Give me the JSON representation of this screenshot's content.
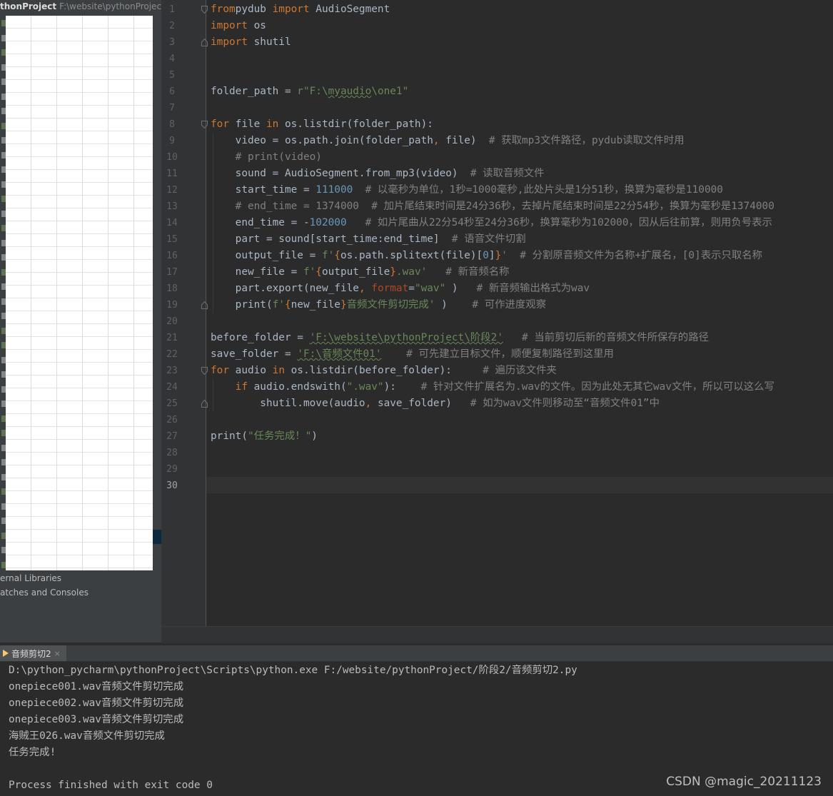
{
  "project": {
    "name": "thonProject",
    "path": "F:\\website\\pythonProject"
  },
  "tree_extra": [
    "ernal Libraries",
    "atches and Consoles"
  ],
  "code_lines": [
    {
      "n": "1",
      "t": [
        [
          "kw",
          "from"
        ],
        [
          "",
          "pydub "
        ],
        [
          "kw",
          "import"
        ],
        [
          "",
          " AudioSegment"
        ]
      ]
    },
    {
      "n": "2",
      "t": [
        [
          "kw",
          "import"
        ],
        [
          "",
          " os"
        ]
      ]
    },
    {
      "n": "3",
      "t": [
        [
          "kw",
          "import"
        ],
        [
          "",
          " shutil"
        ]
      ]
    },
    {
      "n": "4",
      "t": []
    },
    {
      "n": "5",
      "t": []
    },
    {
      "n": "6",
      "t": [
        [
          "",
          "folder_path = "
        ],
        [
          "str",
          "r\"F:\\"
        ],
        [
          "str ul",
          "myaudio"
        ],
        [
          "str",
          "\\one1\""
        ]
      ]
    },
    {
      "n": "7",
      "t": []
    },
    {
      "n": "8",
      "t": [
        [
          "kw",
          "for"
        ],
        [
          "",
          " file "
        ],
        [
          "kw",
          "in"
        ],
        [
          "",
          " os.listdir(folder_path):"
        ]
      ]
    },
    {
      "n": "9",
      "t": [
        [
          "",
          "    video = os.path.join(folder_path"
        ],
        [
          "kw",
          ","
        ],
        [
          "",
          " file)  "
        ],
        [
          "cmt",
          "# 获取mp3文件路径，pydub读取文件时用"
        ]
      ]
    },
    {
      "n": "10",
      "t": [
        [
          "cmt",
          "    # print(video)"
        ]
      ]
    },
    {
      "n": "11",
      "t": [
        [
          "",
          "    sound = AudioSegment.from_mp3(video)  "
        ],
        [
          "cmt",
          "# 读取音频文件"
        ]
      ]
    },
    {
      "n": "12",
      "t": [
        [
          "",
          "    start_time = "
        ],
        [
          "num",
          "111000"
        ],
        [
          "",
          "  "
        ],
        [
          "cmt",
          "# 以毫秒为单位，1秒=1000毫秒,此处片头是1分51秒，换算为毫秒是110000"
        ]
      ]
    },
    {
      "n": "13",
      "t": [
        [
          "cmt",
          "    # end_time = 1374000  # 加片尾结束时间是24分36秒，去掉片尾结束时间是22分54秒，换算为毫秒是1374000"
        ]
      ]
    },
    {
      "n": "14",
      "t": [
        [
          "",
          "    end_time = -"
        ],
        [
          "num",
          "102000"
        ],
        [
          "",
          "   "
        ],
        [
          "cmt",
          "# 如片尾曲从22分54秒至24分36秒，换算毫秒为102000，因从后往前算，则用负号表示"
        ]
      ]
    },
    {
      "n": "15",
      "t": [
        [
          "",
          "    part = sound[start_time:end_time]  "
        ],
        [
          "cmt",
          "# 语音文件切割"
        ]
      ]
    },
    {
      "n": "16",
      "t": [
        [
          "",
          "    output_file = "
        ],
        [
          "str",
          "f'"
        ],
        [
          "kw",
          "{"
        ],
        [
          "",
          "os.path.splitext(file)["
        ],
        [
          "num",
          "0"
        ],
        [
          "",
          "]"
        ],
        [
          "kw",
          "}"
        ],
        [
          "str",
          "'"
        ],
        [
          "",
          "  "
        ],
        [
          "cmt",
          "# 分割原音频文件为名称+扩展名，[0]表示只取名称"
        ]
      ]
    },
    {
      "n": "17",
      "t": [
        [
          "",
          "    new_file = "
        ],
        [
          "str",
          "f'"
        ],
        [
          "kw",
          "{"
        ],
        [
          "",
          "output_file"
        ],
        [
          "kw",
          "}"
        ],
        [
          "str",
          ".wav'"
        ],
        [
          "",
          "   "
        ],
        [
          "cmt",
          "# 新音频名称"
        ]
      ]
    },
    {
      "n": "18",
      "t": [
        [
          "",
          "    part.export(new_file"
        ],
        [
          "kw",
          ","
        ],
        [
          "",
          " "
        ],
        [
          "par",
          "format"
        ],
        [
          "",
          "="
        ],
        [
          "str",
          "\"wav\""
        ],
        [
          "",
          " )   "
        ],
        [
          "cmt",
          "# 新音频输出格式为wav"
        ]
      ]
    },
    {
      "n": "19",
      "t": [
        [
          "",
          "    print("
        ],
        [
          "str",
          "f'"
        ],
        [
          "kw",
          "{"
        ],
        [
          "",
          "new_file"
        ],
        [
          "kw",
          "}"
        ],
        [
          "str",
          "音频文件剪切完成'"
        ],
        [
          "",
          " )    "
        ],
        [
          "cmt",
          "# 可作进度观察"
        ]
      ]
    },
    {
      "n": "20",
      "t": []
    },
    {
      "n": "21",
      "t": [
        [
          "",
          "before_folder = "
        ],
        [
          "str ul",
          "'F:\\website\\pythonProject\\阶段2'"
        ],
        [
          "",
          "   "
        ],
        [
          "cmt",
          "# 当前剪切后新的音频文件所保存的路径"
        ]
      ]
    },
    {
      "n": "22",
      "t": [
        [
          "",
          "save_folder = "
        ],
        [
          "str ul",
          "'F:\\音频文件01'"
        ],
        [
          "",
          "    "
        ],
        [
          "cmt",
          "# 可先建立目标文件，顺便复制路径到这里用"
        ]
      ]
    },
    {
      "n": "23",
      "t": [
        [
          "kw",
          "for"
        ],
        [
          "",
          " audio "
        ],
        [
          "kw",
          "in"
        ],
        [
          "",
          " os.listdir(before_folder):     "
        ],
        [
          "cmt",
          "# 遍历该文件夹"
        ]
      ]
    },
    {
      "n": "24",
      "t": [
        [
          "",
          "    "
        ],
        [
          "kw",
          "if"
        ],
        [
          "",
          " audio.endswith("
        ],
        [
          "str",
          "\".wav\""
        ],
        [
          "",
          "):    "
        ],
        [
          "cmt",
          "# 针对文件扩展名为.wav的文件。因为此处无其它wav文件，所以可以这么写"
        ]
      ]
    },
    {
      "n": "25",
      "t": [
        [
          "",
          "        shutil.move(audio"
        ],
        [
          "kw",
          ","
        ],
        [
          "",
          " save_folder)   "
        ],
        [
          "cmt",
          "# 如为wav文件则移动至“音频文件01”中"
        ]
      ]
    },
    {
      "n": "26",
      "t": []
    },
    {
      "n": "27",
      "t": [
        [
          "",
          "print("
        ],
        [
          "str",
          "\"任务完成！\""
        ],
        [
          "",
          ")"
        ]
      ]
    },
    {
      "n": "28",
      "t": []
    },
    {
      "n": "29",
      "t": []
    },
    {
      "n": "30",
      "t": []
    }
  ],
  "run_tab": {
    "label": "音频剪切2",
    "close": "×"
  },
  "console_lines": [
    "D:\\python_pycharm\\pythonProject\\Scripts\\python.exe F:/website/pythonProject/阶段2/音频剪切2.py",
    "onepiece001.wav音频文件剪切完成",
    "onepiece002.wav音频文件剪切完成",
    "onepiece003.wav音频文件剪切完成",
    "海贼王026.wav音频文件剪切完成",
    "任务完成!",
    "",
    "Process finished with exit code 0"
  ],
  "watermark": "CSDN @magic_20211123",
  "colors": {
    "keyword": "#cc7832",
    "string": "#6a8759",
    "number": "#6897bb",
    "comment": "#808080",
    "text": "#a9b7c6",
    "background": "#2b2b2b"
  },
  "icons": [
    "run-tab-icon",
    "close-icon",
    "fold-marker-icon"
  ]
}
